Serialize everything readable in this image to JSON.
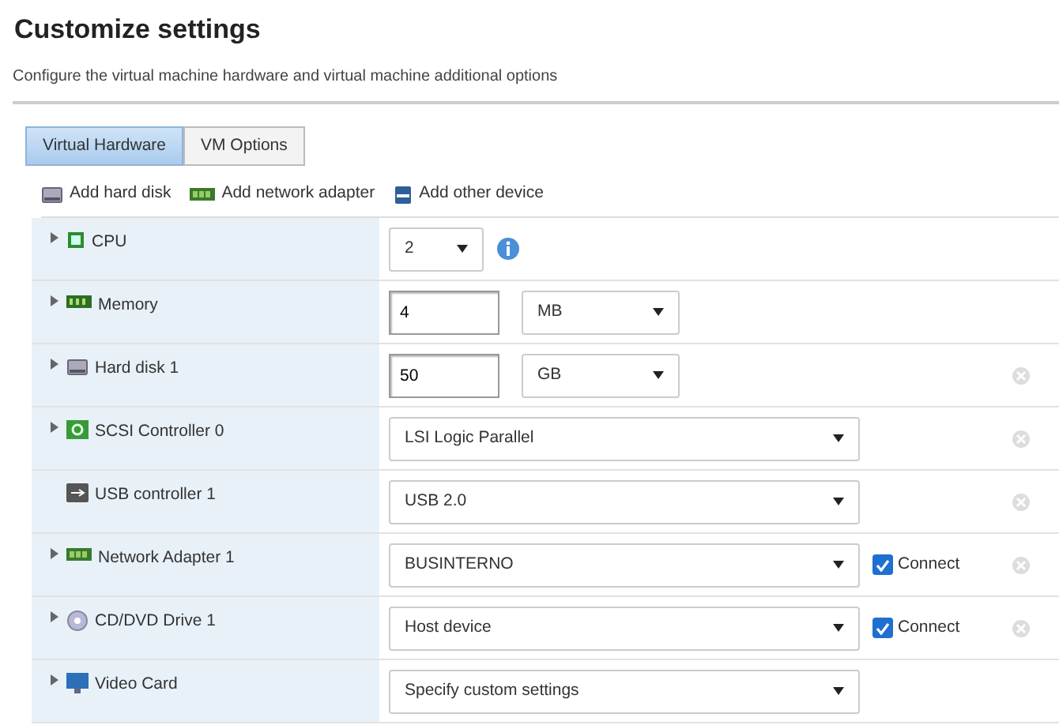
{
  "title": "Customize settings",
  "subtitle": "Configure the virtual machine hardware and virtual machine additional options",
  "tabs": [
    {
      "label": "Virtual Hardware",
      "selected": true
    },
    {
      "label": "VM Options",
      "selected": false
    }
  ],
  "toolbar": [
    "Add hard disk",
    "Add network adapter",
    "Add other device"
  ],
  "rows": [
    {
      "label": "CPU",
      "expandable": true,
      "kind": "short-select",
      "value": "2",
      "info": true,
      "removable": false
    },
    {
      "label": "Memory",
      "expandable": true,
      "kind": "size",
      "value": "4",
      "unit": "MB",
      "removable": false
    },
    {
      "label": "Hard disk 1",
      "expandable": true,
      "kind": "size",
      "value": "50",
      "unit": "GB",
      "removable": true
    },
    {
      "label": "SCSI Controller 0",
      "expandable": true,
      "kind": "select",
      "value": "LSI Logic Parallel",
      "removable": true
    },
    {
      "label": "USB controller 1",
      "expandable": false,
      "kind": "select",
      "value": "USB 2.0",
      "removable": true
    },
    {
      "label": "Network Adapter 1",
      "expandable": true,
      "kind": "select",
      "value": "BUSINTERNO",
      "connect": {
        "label": "Connect",
        "checked": true
      },
      "removable": true
    },
    {
      "label": "CD/DVD Drive 1",
      "expandable": true,
      "kind": "select",
      "value": "Host device",
      "connect": {
        "label": "Connect",
        "checked": true
      },
      "removable": true
    },
    {
      "label": "Video Card",
      "expandable": true,
      "kind": "select",
      "value": "Specify custom settings",
      "removable": false
    }
  ]
}
